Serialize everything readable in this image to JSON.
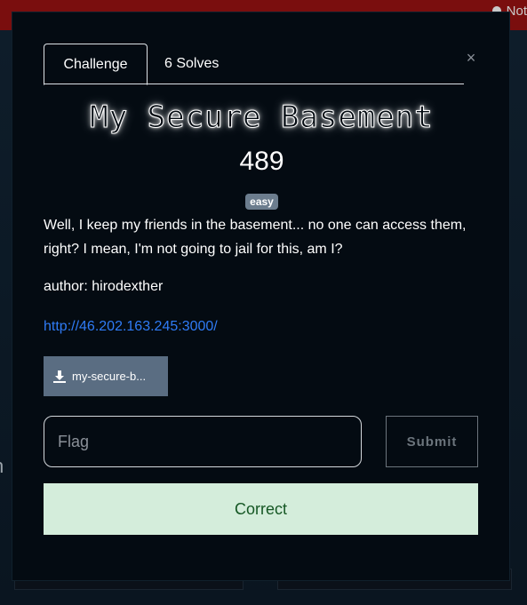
{
  "background": {
    "notifications_label": "Not",
    "fragment_text": "n"
  },
  "modal": {
    "tabs": [
      {
        "label": "Challenge"
      },
      {
        "label": "6 Solves"
      }
    ],
    "close_symbol": "×",
    "challenge": {
      "title": "My Secure Basement",
      "value": "489",
      "difficulty": "easy",
      "description": "Well, I keep my friends in the basement... no one can access them, right? I mean, I'm not going to jail for this, am I?",
      "author": "author: hirodexther",
      "link": "http://46.202.163.245:3000/",
      "file_button": "my-secure-b..."
    },
    "flag_input": {
      "placeholder": "Flag",
      "value": ""
    },
    "submit_label": "Submit",
    "result_message": "Correct"
  },
  "colors": {
    "modal_bg": "#040b12",
    "topbar": "#7a0e0e",
    "link": "#2f7bf5",
    "badge": "#6c7d8e",
    "file_button": "#5a6d82",
    "success_bg": "#d4eddb",
    "success_text": "#155724"
  },
  "icons": {
    "notification": "bell-icon",
    "download": "download-icon",
    "close": "close-icon"
  }
}
